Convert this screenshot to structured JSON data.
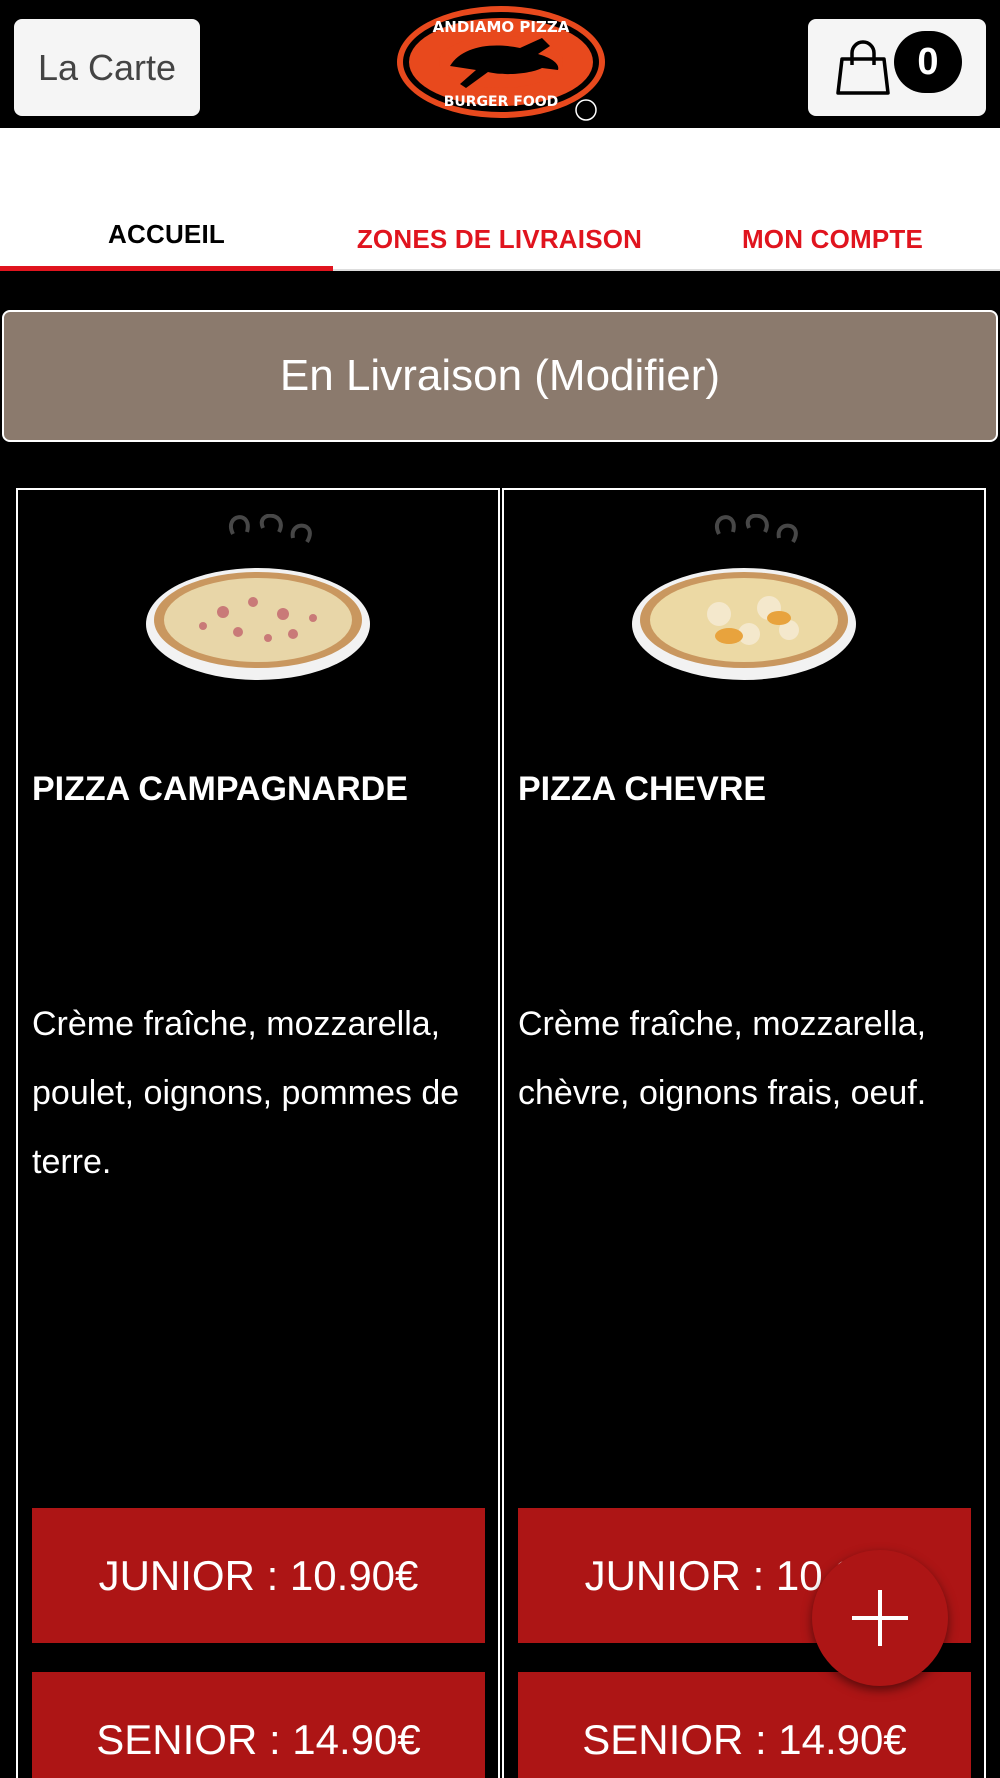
{
  "header": {
    "menu_label": "La Carte",
    "logo_icon": "andiamo-pizza-burger-food-logo",
    "cart_icon": "shopping-bag-icon",
    "cart_count": "0"
  },
  "nav": {
    "tabs": [
      {
        "label": "ACCUEIL",
        "active": true
      },
      {
        "label": "ZONES DE LIVRAISON",
        "active": false
      },
      {
        "label": "MON COMPTE",
        "active": false
      }
    ]
  },
  "mode": {
    "label": "En Livraison (Modifier)"
  },
  "products": [
    {
      "title": "PIZZA CAMPAGNARDE",
      "description": "Crème fraîche, mozzarella, poulet, oignons, pommes de terre.",
      "junior": "JUNIOR : 10.90€",
      "senior": "SENIOR : 14.90€"
    },
    {
      "title": "PIZZA CHEVRE",
      "description": "Crème fraîche, mozzarella, chèvre, oignons frais, oeuf.",
      "junior": "JUNIOR : 10.90€",
      "senior": "SENIOR : 14.90€"
    }
  ],
  "colors": {
    "accent_red": "#e0141e",
    "button_red": "#ad1515",
    "mode_bar": "#8b7a6d",
    "background": "#000000"
  },
  "fab": {
    "icon": "plus-icon"
  }
}
